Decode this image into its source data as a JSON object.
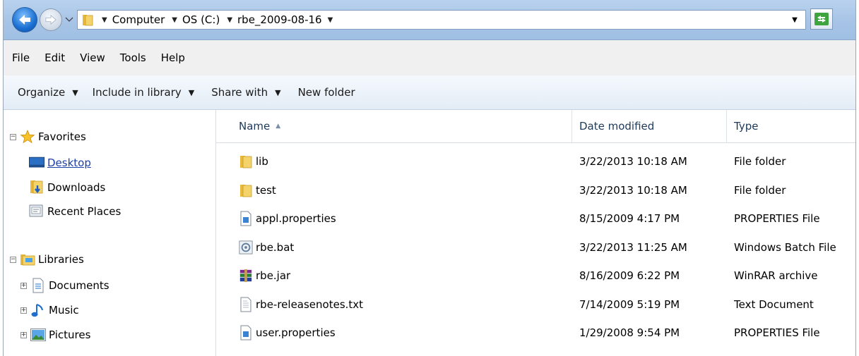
{
  "address_bar": {
    "crumbs": [
      "Computer",
      "OS (C:)",
      "rbe_2009-08-16"
    ]
  },
  "menu": {
    "items": [
      "File",
      "Edit",
      "View",
      "Tools",
      "Help"
    ]
  },
  "commands": {
    "organize": "Organize",
    "include_in_library": "Include in library",
    "share_with": "Share with",
    "new_folder": "New folder"
  },
  "nav": {
    "favorites": {
      "label": "Favorites",
      "items": [
        "Desktop",
        "Downloads",
        "Recent Places"
      ]
    },
    "libraries": {
      "label": "Libraries",
      "items": [
        "Documents",
        "Music",
        "Pictures"
      ]
    }
  },
  "columns": {
    "name": "Name",
    "date_modified": "Date modified",
    "type": "Type"
  },
  "files": [
    {
      "name": "lib",
      "date": "3/22/2013 10:18 AM",
      "type": "File folder",
      "icon": "folder-icon"
    },
    {
      "name": "test",
      "date": "3/22/2013 10:18 AM",
      "type": "File folder",
      "icon": "folder-icon"
    },
    {
      "name": "appl.properties",
      "date": "8/15/2009 4:17 PM",
      "type": "PROPERTIES File",
      "icon": "properties-file-icon"
    },
    {
      "name": "rbe.bat",
      "date": "3/22/2013 11:25 AM",
      "type": "Windows Batch File",
      "icon": "batch-file-icon"
    },
    {
      "name": "rbe.jar",
      "date": "8/16/2009 6:22 PM",
      "type": "WinRAR archive",
      "icon": "winrar-archive-icon"
    },
    {
      "name": "rbe-releasenotes.txt",
      "date": "7/14/2009 5:19 PM",
      "type": "Text Document",
      "icon": "text-file-icon"
    },
    {
      "name": "user.properties",
      "date": "1/29/2008 9:54 PM",
      "type": "PROPERTIES File",
      "icon": "properties-file-icon"
    }
  ]
}
